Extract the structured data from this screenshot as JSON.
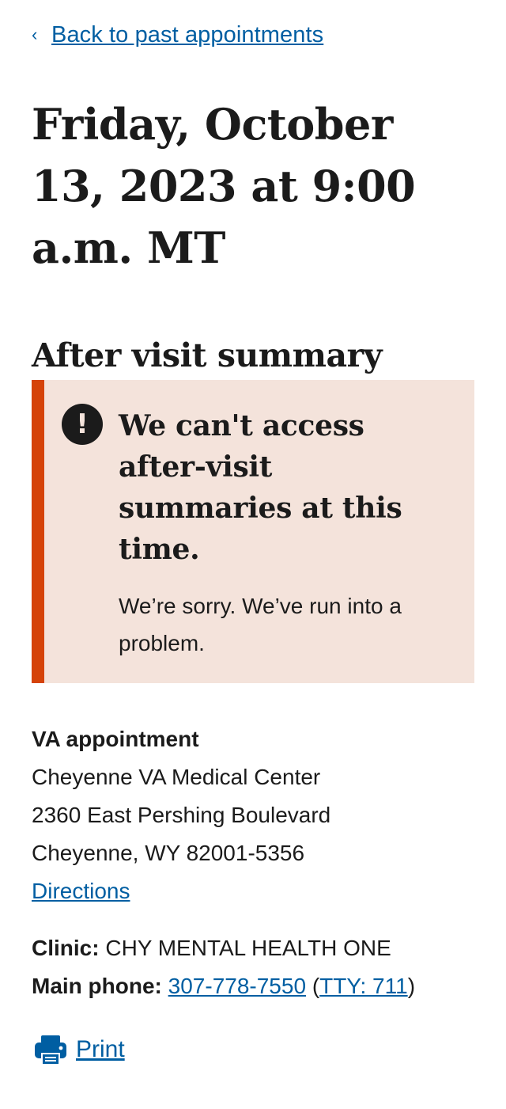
{
  "nav": {
    "back_chevron": "‹",
    "back_label": "Back to past appointments"
  },
  "appointment": {
    "title": "Friday, October 13, 2023 at 9:00 a.m. MT"
  },
  "summary": {
    "heading": "After visit summary",
    "alert": {
      "icon": "!",
      "heading": "We can't access after-visit summaries at this time.",
      "body": "We’re sorry. We’ve run into a problem."
    }
  },
  "location": {
    "type_label": "VA appointment",
    "facility": "Cheyenne VA Medical Center",
    "street": "2360 East Pershing Boulevard",
    "city_state_zip": "Cheyenne, WY 82001-5356",
    "directions_label": "Directions"
  },
  "clinic": {
    "clinic_label": "Clinic:",
    "clinic_name": "CHY MENTAL HEALTH ONE",
    "phone_label": "Main phone:",
    "phone_number": "307-778-7550",
    "tty_open": "(",
    "tty_label": "TTY: 711",
    "tty_close": ")"
  },
  "actions": {
    "print_label": "Print"
  },
  "colors": {
    "link": "#005ea2",
    "alert_border": "#d54309",
    "alert_background": "#f4e3db",
    "text": "#1b1b1b"
  },
  "icons": {
    "back": "chevron-left-icon",
    "alert": "exclamation-circle-icon",
    "print": "printer-icon"
  }
}
